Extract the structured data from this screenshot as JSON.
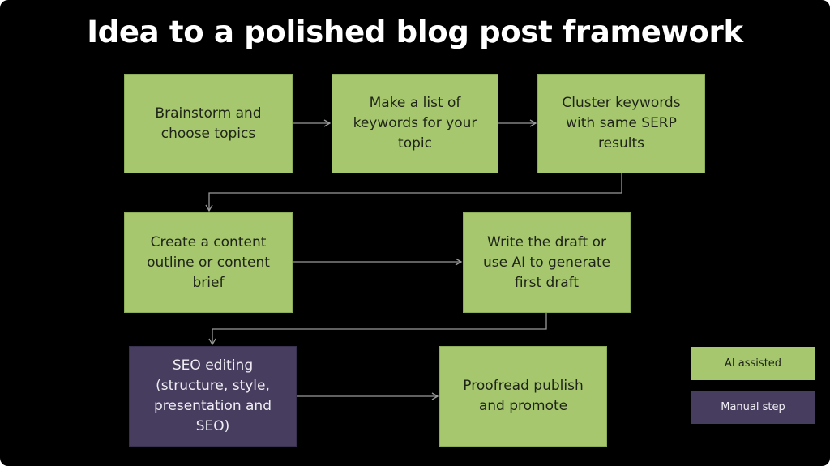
{
  "title": "Idea to a polished blog post framework",
  "colors": {
    "background": "#000000",
    "ai_assisted": "#a6c76d",
    "manual_step": "#473d5f",
    "connector": "#9a9a9a"
  },
  "steps": [
    {
      "id": "brainstorm",
      "label": "Brainstorm and choose topics",
      "type": "ai_assisted"
    },
    {
      "id": "keywords",
      "label": "Make a list of keywords for your topic",
      "type": "ai_assisted"
    },
    {
      "id": "cluster",
      "label": "Cluster keywords with same SERP results",
      "type": "ai_assisted"
    },
    {
      "id": "outline",
      "label": "Create a content outline or content brief",
      "type": "ai_assisted"
    },
    {
      "id": "draft",
      "label": "Write the draft or use AI to generate first draft",
      "type": "ai_assisted"
    },
    {
      "id": "seo",
      "label": "SEO editing (structure, style, presentation and SEO)",
      "type": "manual_step"
    },
    {
      "id": "publish",
      "label": "Proofread publish and promote",
      "type": "ai_assisted"
    }
  ],
  "flow": [
    [
      "brainstorm",
      "keywords"
    ],
    [
      "keywords",
      "cluster"
    ],
    [
      "cluster",
      "outline"
    ],
    [
      "outline",
      "draft"
    ],
    [
      "draft",
      "seo"
    ],
    [
      "seo",
      "publish"
    ]
  ],
  "legend": {
    "ai_assisted": "AI assisted",
    "manual_step": "Manual step"
  }
}
